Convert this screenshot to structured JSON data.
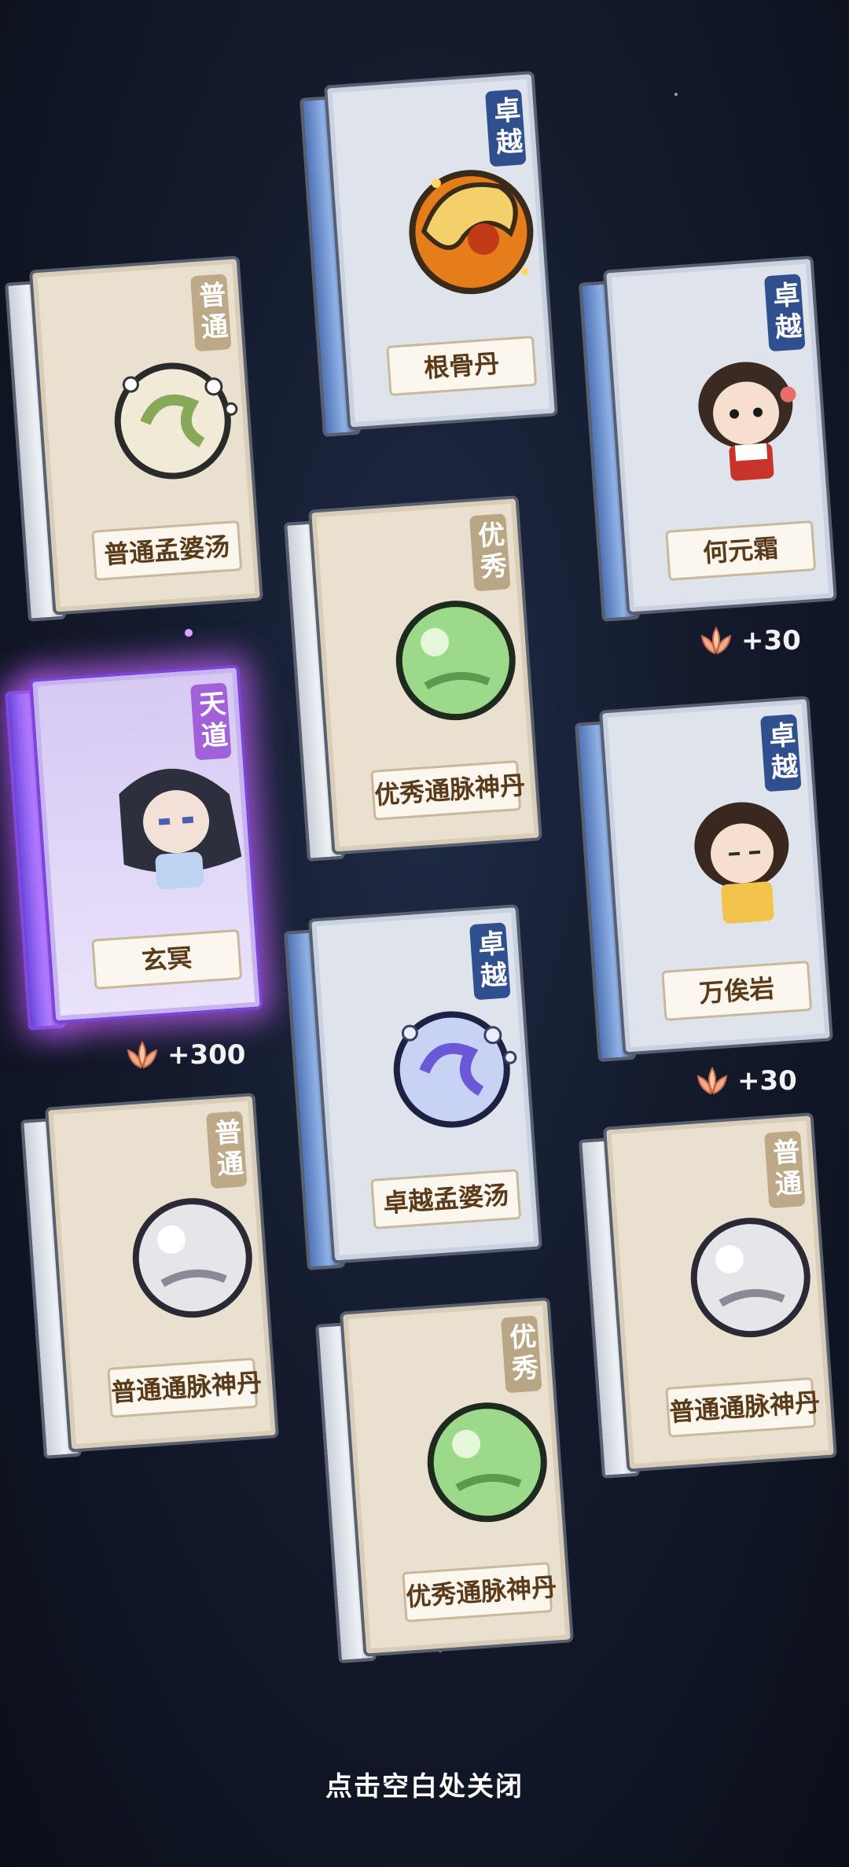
{
  "close_hint": "点击空白处关闭",
  "cards": [
    {
      "id": "c1",
      "name": "根骨丹",
      "quality": "卓越",
      "icon": "golden-orb-icon"
    },
    {
      "id": "c2",
      "name": "普通孟婆汤",
      "quality": "普通",
      "icon": "soup-bubbles-icon"
    },
    {
      "id": "c3",
      "name": "何元霜",
      "quality": "卓越",
      "icon": "girl-character-icon",
      "bonus": "+30"
    },
    {
      "id": "c4",
      "name": "优秀通脉神丹",
      "quality": "优秀",
      "icon": "green-pill-icon"
    },
    {
      "id": "c5",
      "name": "玄冥",
      "quality": "天道",
      "icon": "swordsman-character-icon",
      "bonus": "+300"
    },
    {
      "id": "c6",
      "name": "万俟岩",
      "quality": "卓越",
      "icon": "boy-character-icon",
      "bonus": "+30"
    },
    {
      "id": "c7",
      "name": "卓越孟婆汤",
      "quality": "卓越",
      "icon": "soup-bubbles-blue-icon"
    },
    {
      "id": "c8",
      "name": "普通通脉神丹",
      "quality": "普通",
      "icon": "silver-pill-icon"
    },
    {
      "id": "c9",
      "name": "普通通脉神丹",
      "quality": "普通",
      "icon": "silver-pill-icon"
    },
    {
      "id": "c10",
      "name": "优秀通脉神丹",
      "quality": "优秀",
      "icon": "green-pill-icon"
    }
  ]
}
